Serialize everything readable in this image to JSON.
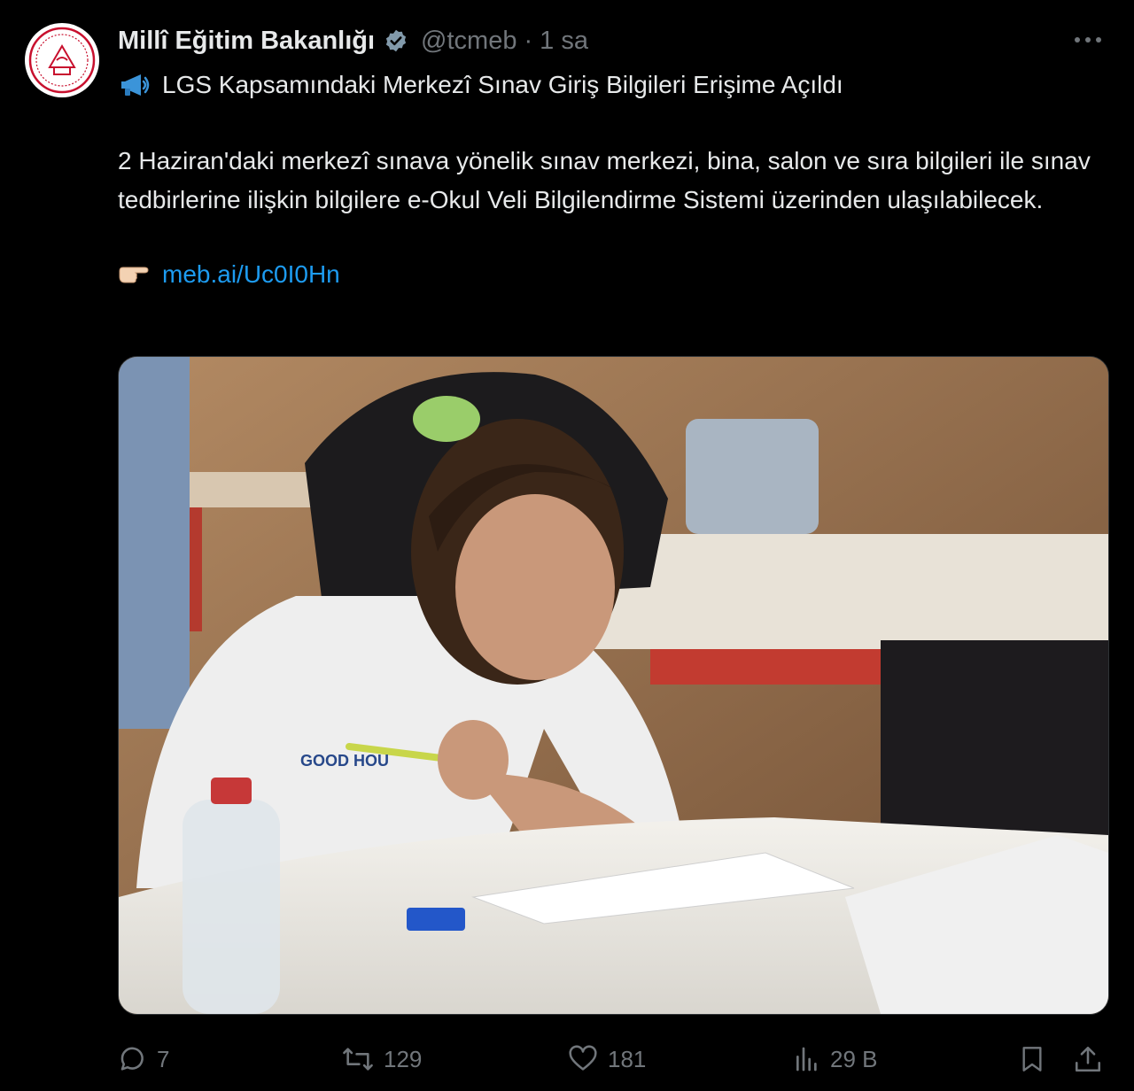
{
  "tweet": {
    "author_name": "Millî Eğitim Bakanlığı",
    "handle": "@tcmeb",
    "separator": "·",
    "time": "1 sa",
    "headline": "LGS Kapsamındaki Merkezî Sınav Giriş Bilgileri Erişime Açıldı",
    "body": "2 Haziran'daki merkezî sınava yönelik sınav merkezi, bina, salon ve sıra bilgileri ile sınav tedbirlerine ilişkin bilgilere e-Okul Veli Bilgilendirme Sistemi üzerinden ulaşılabilecek.",
    "link_text": "meb.ai/Uc0I0Hn",
    "shirt_text": "GOOD HOU"
  },
  "actions": {
    "reply_count": "7",
    "retweet_count": "129",
    "like_count": "181",
    "views_count": "29 B"
  },
  "colors": {
    "background": "#000000",
    "text": "#e7e9ea",
    "muted": "#71767b",
    "link": "#1d9bf0",
    "logo_red": "#c8102e"
  },
  "icons": {
    "verified": "verified-badge-icon",
    "more": "more-horizontal-icon",
    "megaphone": "megaphone-icon",
    "pointer": "pointing-hand-icon",
    "reply": "reply-icon",
    "retweet": "retweet-icon",
    "like": "heart-icon",
    "views": "views-chart-icon",
    "bookmark": "bookmark-icon",
    "share": "share-icon"
  }
}
